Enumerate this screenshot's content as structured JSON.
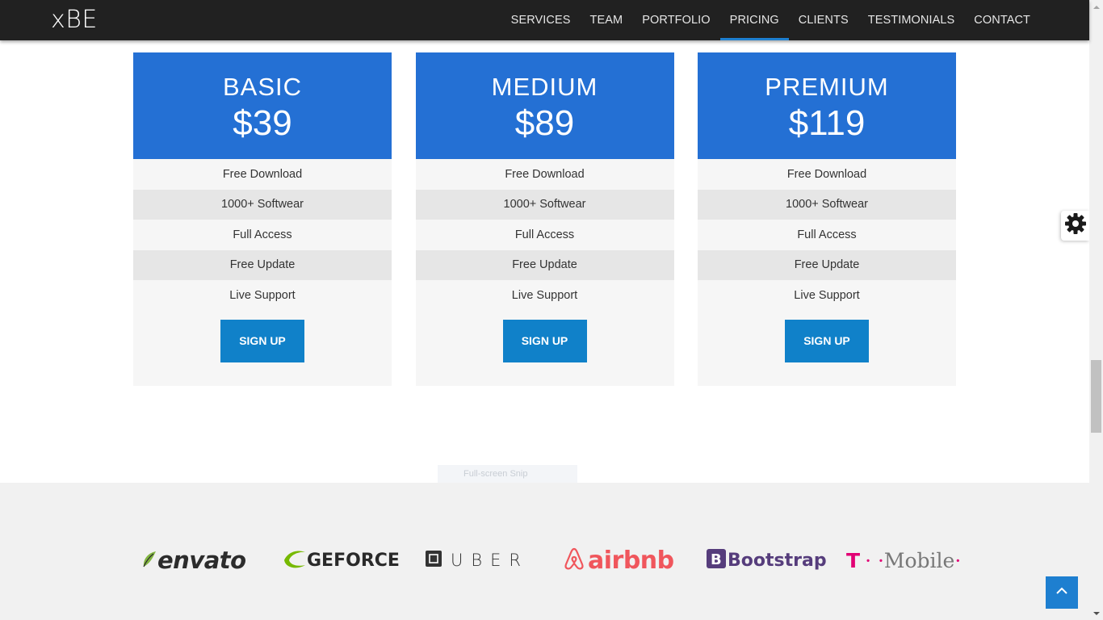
{
  "header": {
    "brand": "xBE",
    "nav": [
      {
        "label": "SERVICES"
      },
      {
        "label": "TEAM"
      },
      {
        "label": "PORTFOLIO"
      },
      {
        "label": "PRICING",
        "active": true
      },
      {
        "label": "CLIENTS"
      },
      {
        "label": "TESTIMONIALS"
      },
      {
        "label": "CONTACT"
      }
    ]
  },
  "pricing": {
    "plans": [
      {
        "name": "BASIC",
        "price": "$39",
        "features": [
          "Free Download",
          "1000+ Softwear",
          "Full Access",
          "Free Update",
          "Live Support"
        ],
        "button": "SIGN UP"
      },
      {
        "name": "MEDIUM",
        "price": "$89",
        "features": [
          "Free Download",
          "1000+ Softwear",
          "Full Access",
          "Free Update",
          "Live Support"
        ],
        "button": "SIGN UP"
      },
      {
        "name": "PREMIUM",
        "price": "$119",
        "features": [
          "Free Download",
          "1000+ Softwear",
          "Full Access",
          "Free Update",
          "Live Support"
        ],
        "button": "SIGN UP"
      }
    ]
  },
  "overlay": {
    "snip_label": "Full-screen Snip"
  },
  "clients": {
    "logos": [
      {
        "name": "envato",
        "text": "envato",
        "icon": "leaf-icon"
      },
      {
        "name": "geforce",
        "text": "GEFORCE",
        "icon": "nvidia-swoosh-icon"
      },
      {
        "name": "uber",
        "text": "UBER",
        "icon": "uber-square-icon"
      },
      {
        "name": "airbnb",
        "text": "airbnb",
        "icon": "airbnb-belo-icon"
      },
      {
        "name": "bootstrap",
        "text": "Bootstrap",
        "icon": "bootstrap-b-icon"
      },
      {
        "name": "tmobile",
        "text": "Mobile",
        "icon": "t-logo-icon",
        "prefix": "T"
      }
    ]
  },
  "widgets": {
    "settings_icon": "gear-icon",
    "to_top_icon": "chevron-up-icon"
  },
  "colors": {
    "header_bg": "#212121",
    "plan_head": "#2470d4",
    "button": "#1081c9",
    "active_underline": "#1e7fd0",
    "airbnb": "#f0565c",
    "bootstrap": "#563d7c",
    "tmobile": "#e20074"
  }
}
